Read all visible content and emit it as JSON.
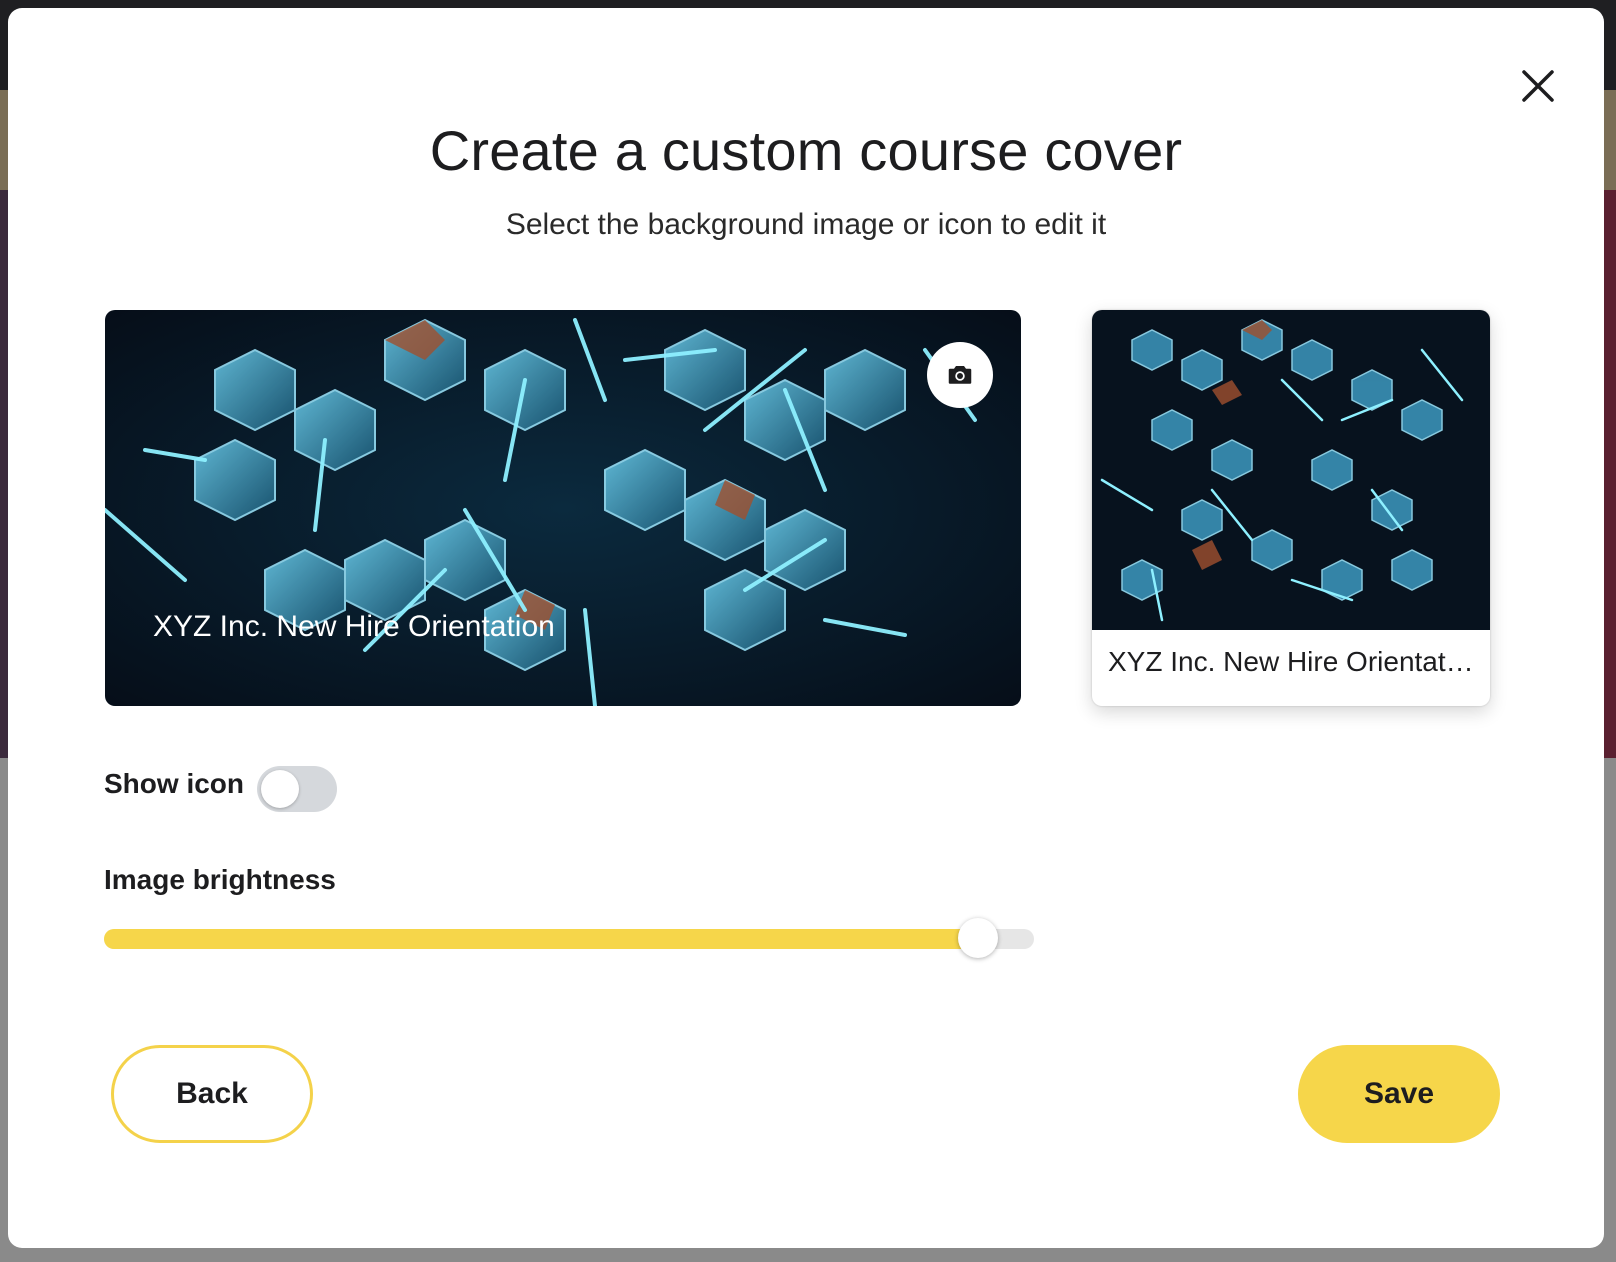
{
  "modal": {
    "title": "Create a custom course cover",
    "subtitle": "Select the background image or icon to edit it",
    "close_icon": "close-icon"
  },
  "cover": {
    "title": "XYZ Inc. New Hire Orientation",
    "camera_icon": "camera-icon"
  },
  "preview": {
    "label": "XYZ Inc. New Hire Orientation"
  },
  "controls": {
    "show_icon_label": "Show icon",
    "show_icon_on": false,
    "brightness_label": "Image brightness",
    "brightness_value": 0.94
  },
  "buttons": {
    "back_label": "Back",
    "save_label": "Save"
  },
  "colors": {
    "accent": "#f6d64a",
    "text": "#1d1d1f",
    "toggle_off": "#d5d8dc"
  }
}
